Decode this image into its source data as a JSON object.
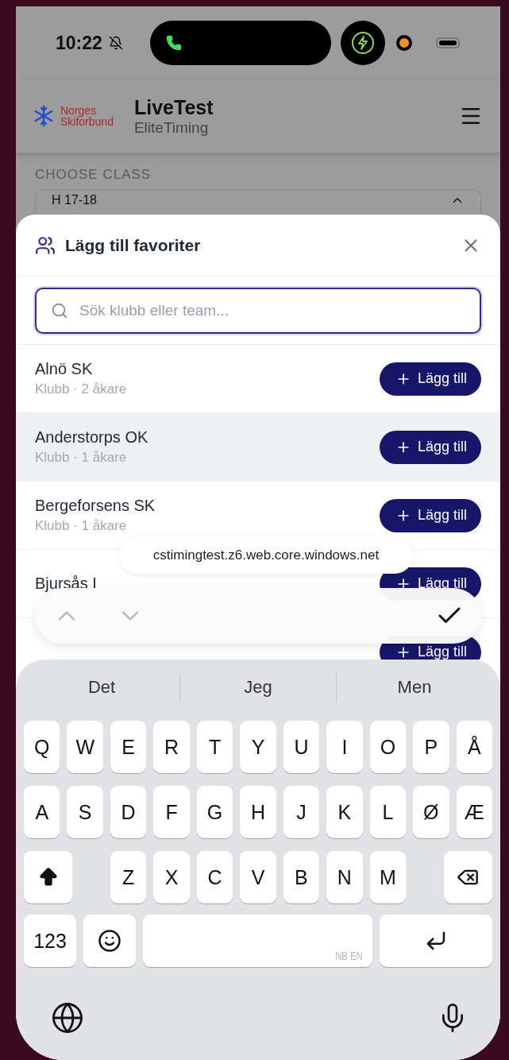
{
  "status_bar": {
    "time": "10:22"
  },
  "header": {
    "logo_lines": [
      "Norges",
      "Skiforbund"
    ],
    "title": "LiveTest",
    "subtitle": "EliteTiming"
  },
  "class_select": {
    "label": "CHOOSE CLASS",
    "value": "H 17-18"
  },
  "sheet": {
    "title": "Lägg till favoriter",
    "search": {
      "placeholder": "Sök klubb eller team..."
    },
    "rows": [
      {
        "name": "Alnö SK",
        "meta": "Klubb · 2 åkare",
        "button": "Lägg till",
        "selected": false
      },
      {
        "name": "Anderstorps OK",
        "meta": "Klubb · 1 åkare",
        "button": "Lägg till",
        "selected": true
      },
      {
        "name": "Bergeforsens SK",
        "meta": "Klubb · 1 åkare",
        "button": "Lägg till",
        "selected": false
      },
      {
        "name": "Bjursås I",
        "button": "Lägg till",
        "selected": false
      },
      {
        "button": "Lägg till",
        "selected": false
      }
    ]
  },
  "url_pill": "cstimingtest.z6.web.core.windows.net",
  "keyboard": {
    "suggestions": [
      "Det",
      "Jeg",
      "Men"
    ],
    "rows": [
      [
        "Q",
        "W",
        "E",
        "R",
        "T",
        "Y",
        "U",
        "I",
        "O",
        "P",
        "Å"
      ],
      [
        "A",
        "S",
        "D",
        "F",
        "G",
        "H",
        "J",
        "K",
        "L",
        "Ø",
        "Æ"
      ],
      [
        "",
        "",
        "Z",
        "X",
        "C",
        "V",
        "B",
        "N",
        "M",
        "",
        ""
      ]
    ],
    "numbers_key": "123",
    "space_label": "NB EN"
  }
}
